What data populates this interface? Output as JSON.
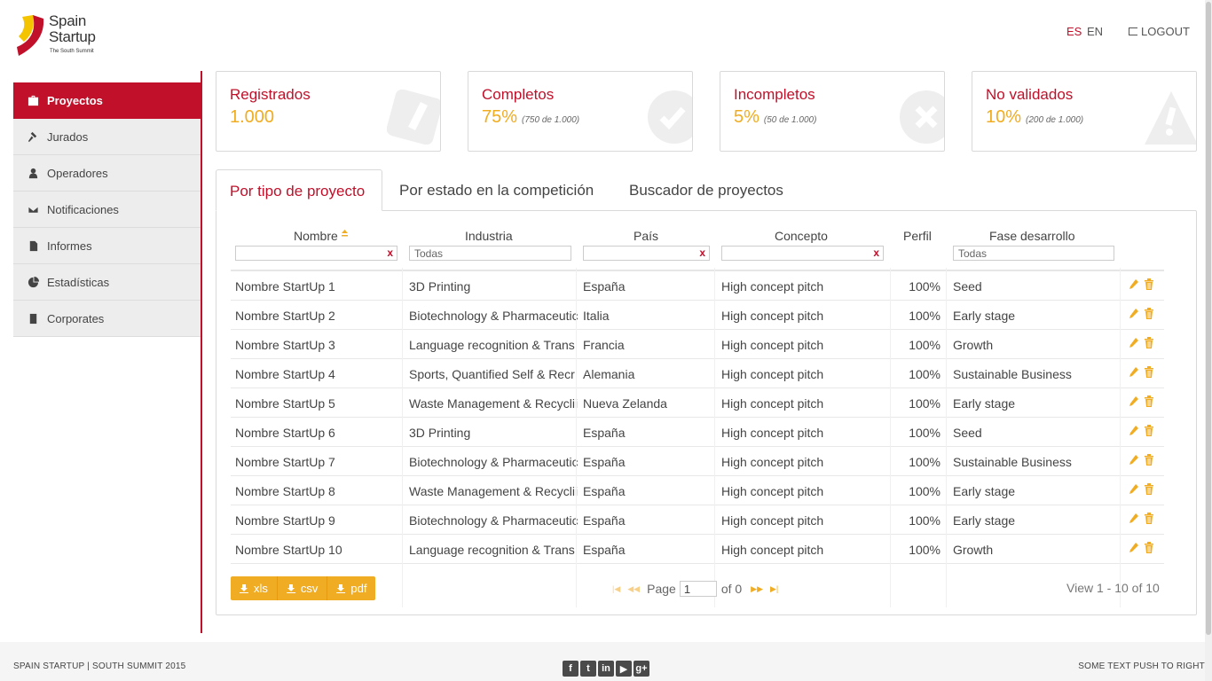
{
  "brand": {
    "line1": "Spain",
    "line2": "Startup",
    "tagline": "The South Summit",
    "red": "#c0102a",
    "yellow": "#f0ad23"
  },
  "header": {
    "lang_es": "ES",
    "lang_en": "EN",
    "logout": "LOGOUT"
  },
  "sidebar": {
    "items": [
      {
        "label": "Proyectos",
        "icon": "briefcase-icon",
        "active": true
      },
      {
        "label": "Jurados",
        "icon": "gavel-icon"
      },
      {
        "label": "Operadores",
        "icon": "user-icon"
      },
      {
        "label": "Notificaciones",
        "icon": "envelope-icon"
      },
      {
        "label": "Informes",
        "icon": "file-icon"
      },
      {
        "label": "Estadísticas",
        "icon": "pie-chart-icon"
      },
      {
        "label": "Corporates",
        "icon": "building-icon"
      }
    ]
  },
  "stats": [
    {
      "title": "Registrados",
      "value": "1.000",
      "sub": "",
      "icon": "pencil-icon"
    },
    {
      "title": "Completos",
      "value": "75%",
      "sub": "(750 de 1.000)",
      "icon": "check-icon"
    },
    {
      "title": "Incompletos",
      "value": "5%",
      "sub": "(50 de 1.000)",
      "icon": "x-icon"
    },
    {
      "title": "No validados",
      "value": "10%",
      "sub": "(200 de 1.000)",
      "icon": "warning-icon"
    }
  ],
  "tabs": [
    {
      "label": "Por tipo de proyecto",
      "active": true
    },
    {
      "label": "Por estado en la competición"
    },
    {
      "label": "Buscador de proyectos"
    }
  ],
  "table": {
    "headers": {
      "nombre": "Nombre",
      "industria": "Industria",
      "pais": "País",
      "concepto": "Concepto",
      "perfil": "Perfil",
      "fase": "Fase desarrollo"
    },
    "filters": {
      "nombre": "",
      "industria": "Todas",
      "pais": "",
      "concepto": "",
      "fase": "Todas",
      "clear": "x"
    },
    "rows": [
      {
        "nombre": "Nombre StartUp 1",
        "industria": "3D Printing",
        "pais": "España",
        "concepto": "High concept pitch",
        "perfil": "100%",
        "fase": "Seed"
      },
      {
        "nombre": "Nombre StartUp 2",
        "industria": "Biotechnology & Pharmaceutic",
        "pais": "Italia",
        "concepto": "High concept pitch",
        "perfil": "100%",
        "fase": "Early stage"
      },
      {
        "nombre": "Nombre StartUp 3",
        "industria": "Language recognition & Trans",
        "pais": "Francia",
        "concepto": "High concept pitch",
        "perfil": "100%",
        "fase": "Growth"
      },
      {
        "nombre": "Nombre StartUp 4",
        "industria": "Sports, Quantified Self & Recr",
        "pais": "Alemania",
        "concepto": "High concept pitch",
        "perfil": "100%",
        "fase": "Sustainable Business"
      },
      {
        "nombre": "Nombre StartUp 5",
        "industria": "Waste Management & Recyclii",
        "pais": "Nueva Zelanda",
        "concepto": "High concept pitch",
        "perfil": "100%",
        "fase": "Early stage"
      },
      {
        "nombre": "Nombre StartUp 6",
        "industria": "3D Printing",
        "pais": "España",
        "concepto": "High concept pitch",
        "perfil": "100%",
        "fase": "Seed"
      },
      {
        "nombre": "Nombre StartUp 7",
        "industria": "Biotechnology & Pharmaceutic",
        "pais": "España",
        "concepto": "High concept pitch",
        "perfil": "100%",
        "fase": "Sustainable Business"
      },
      {
        "nombre": "Nombre StartUp 8",
        "industria": "Waste Management & Recyclii",
        "pais": "España",
        "concepto": "High concept pitch",
        "perfil": "100%",
        "fase": "Early stage"
      },
      {
        "nombre": "Nombre StartUp 9",
        "industria": "Biotechnology & Pharmaceutic",
        "pais": "España",
        "concepto": "High concept pitch",
        "perfil": "100%",
        "fase": "Early stage"
      },
      {
        "nombre": "Nombre StartUp 10",
        "industria": "Language recognition & Trans",
        "pais": "España",
        "concepto": "High concept pitch",
        "perfil": "100%",
        "fase": "Growth"
      }
    ]
  },
  "exports": {
    "xls": "xls",
    "csv": "csv",
    "pdf": "pdf"
  },
  "pager": {
    "page_label": "Page",
    "page_value": "1",
    "of_label": "of 0",
    "view": "View 1 - 10 of 10"
  },
  "footer": {
    "left": "SPAIN STARTUP | SOUTH SUMMIT 2015",
    "right": "SOME TEXT PUSH TO RIGHT",
    "social": [
      "facebook-icon",
      "twitter-icon",
      "linkedin-icon",
      "youtube-icon",
      "google-plus-icon"
    ]
  }
}
